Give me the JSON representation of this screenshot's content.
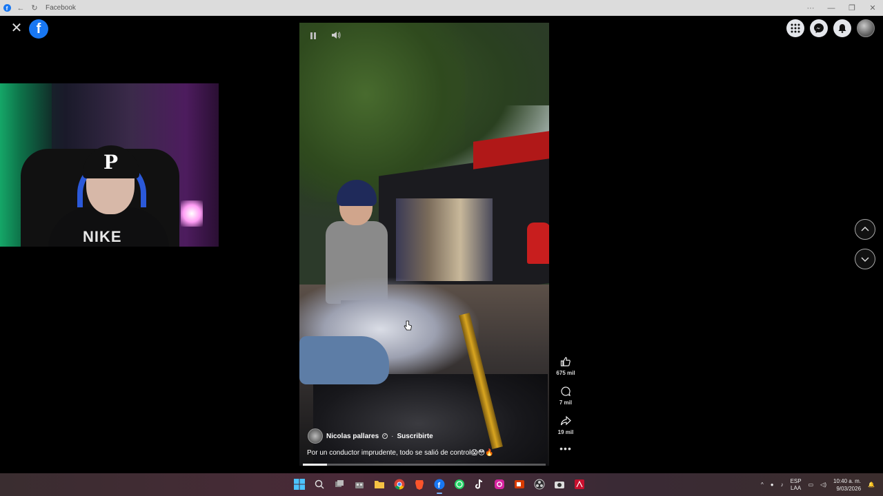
{
  "window": {
    "title": "Facebook"
  },
  "titlebar": {
    "back_icon": "arrow-left-icon",
    "reload_icon": "reload-icon",
    "controls": [
      "···",
      "—",
      "❐",
      "✕"
    ]
  },
  "header": {
    "close_glyph": "✕",
    "logo_letter": "f",
    "right_buttons": [
      "menu-grid-icon",
      "messenger-icon",
      "notifications-bell-icon"
    ]
  },
  "video": {
    "author": "Nicolas pallares",
    "subscribe_label": "Suscribirte",
    "separator": "·",
    "verified_glyph": "✓",
    "caption": "Por un conductor imprudente, todo se salió de control😱😳🔥",
    "progress": 0.1
  },
  "actions": {
    "likes": "675 mil",
    "comments": "7 mil",
    "shares": "19 mil",
    "more": "•••"
  },
  "webcam": {
    "cap_letter": "P",
    "shirt_text": "NIKE"
  },
  "taskbar": {
    "apps": [
      "windows-start",
      "search",
      "task-view",
      "store",
      "file-explorer",
      "chrome",
      "brave",
      "facebook",
      "whatsapp",
      "tiktok",
      "instagram",
      "office",
      "obs",
      "camera",
      "acrobat"
    ],
    "language": "ESP",
    "layout": "LAA",
    "time": "10:40 a. m.",
    "date": "9/03/2026"
  },
  "colors": {
    "facebook_blue": "#1877f2",
    "background": "#000000"
  }
}
